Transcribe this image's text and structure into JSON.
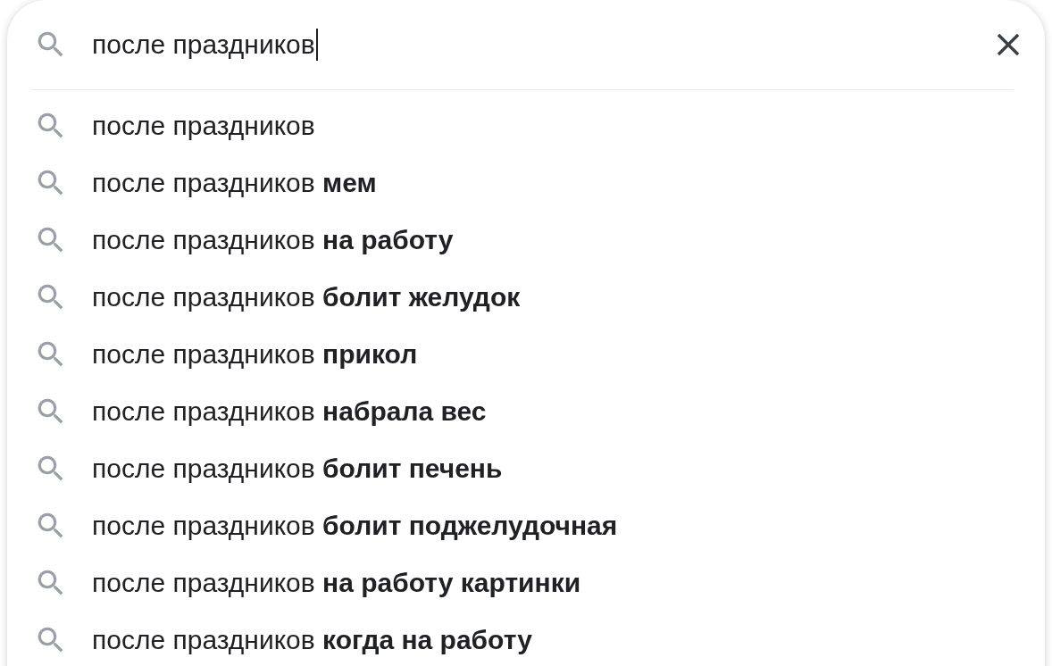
{
  "search": {
    "value": "после праздников"
  },
  "suggestions": [
    {
      "text": "после праздников"
    },
    {
      "text": "после праздников **мем**"
    },
    {
      "text": "после праздников **на работу**"
    },
    {
      "text": "после праздников **болит желудок**"
    },
    {
      "text": "после праздников **прикол**"
    },
    {
      "text": "после праздников **набрала вес**"
    },
    {
      "text": "после праздников **болит печень**"
    },
    {
      "text": "после праздников **болит поджелудочная**"
    },
    {
      "text": "после праздников **на работу картинки**"
    },
    {
      "text": "после праздников **когда на работу**"
    }
  ]
}
